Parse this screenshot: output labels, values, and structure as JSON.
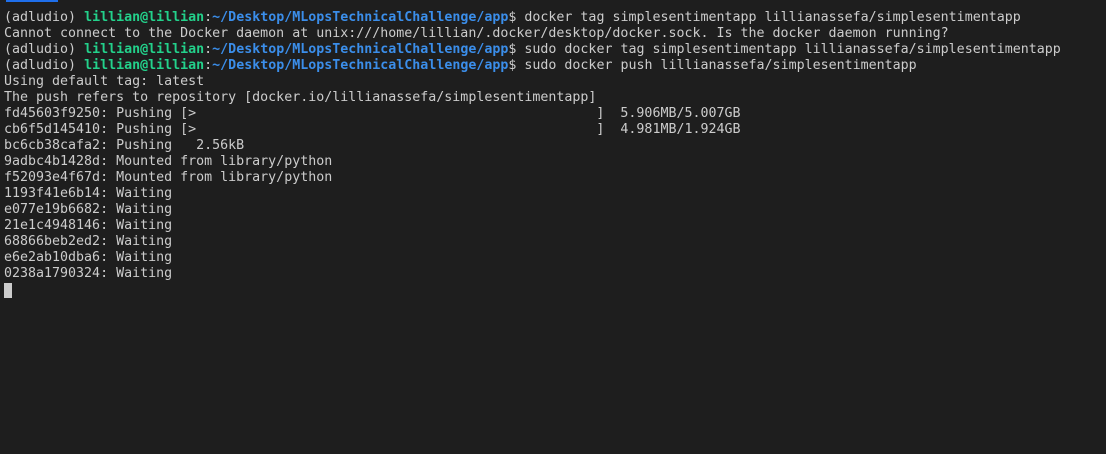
{
  "colors": {
    "background": "#1e1e1e",
    "text": "#cccccc",
    "user": "#23d18b",
    "path": "#3b8eea",
    "scroll_indicator": "#1f6feb"
  },
  "prompt": {
    "env": "(adludio) ",
    "user": "lillian@lillian",
    "colon": ":",
    "path": "~/Desktop/MLopsTechnicalChallenge/app",
    "symbol": "$ "
  },
  "commands": [
    "docker tag simplesentimentapp lillianassefa/simplesentimentapp",
    "sudo docker tag simplesentimentapp lillianassefa/simplesentimentapp",
    "sudo docker push lillianassefa/simplesentimentapp"
  ],
  "outputs": {
    "docker_error": "Cannot connect to the Docker daemon at unix:///home/lillian/.docker/desktop/docker.sock. Is the docker daemon running?",
    "default_tag": "Using default tag: latest",
    "push_refers": "The push refers to repository [docker.io/lillianassefa/simplesentimentapp]",
    "layers": [
      "fd45603f9250: Pushing [>                                                  ]  5.906MB/5.007GB",
      "cb6f5d145410: Pushing [>                                                  ]  4.981MB/1.924GB",
      "bc6cb38cafa2: Pushing   2.56kB",
      "9adbc4b1428d: Mounted from library/python",
      "f52093e4f67d: Mounted from library/python",
      "1193f41e6b14: Waiting",
      "e077e19b6682: Waiting",
      "21e1c4948146: Waiting",
      "68866beb2ed2: Waiting",
      "e6e2ab10dba6: Waiting",
      "0238a1790324: Waiting"
    ]
  }
}
